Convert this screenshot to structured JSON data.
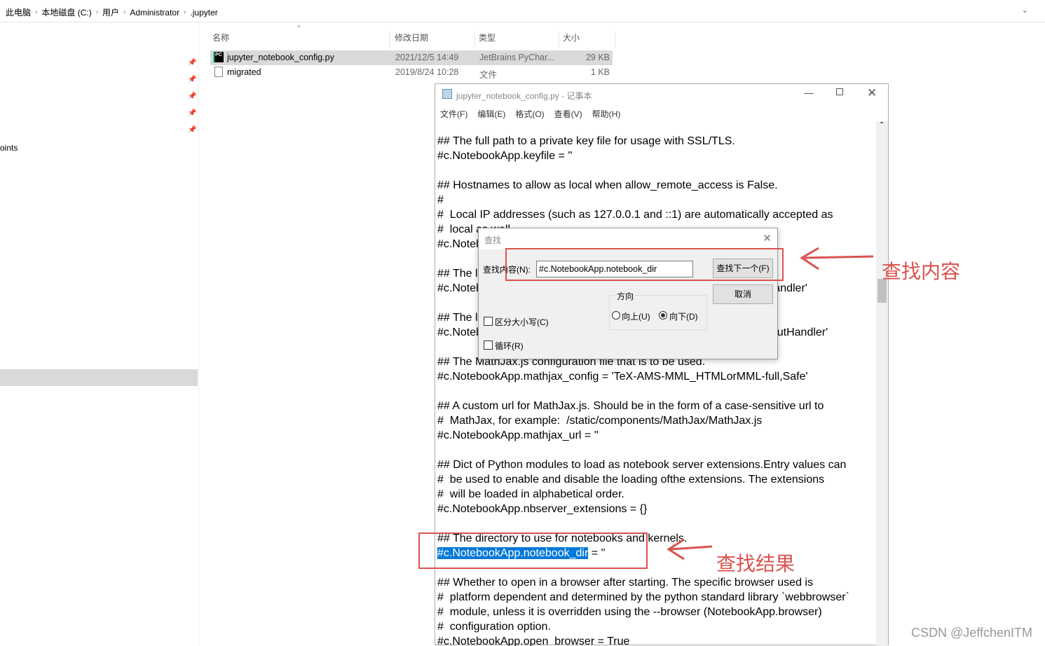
{
  "breadcrumb": [
    "此电脑",
    "本地磁盘 (C:)",
    "用户",
    "Administrator",
    ".jupyter"
  ],
  "left_pane_partial": "oints",
  "columns": [
    "名称",
    "修改日期",
    "类型",
    "大小"
  ],
  "files": [
    {
      "name": "jupyter_notebook_config.py",
      "date": "2021/12/5 14:49",
      "type": "JetBrains PyChar...",
      "size": "29 KB",
      "icon": "pycharm-file-icon"
    },
    {
      "name": "migrated",
      "date": "2019/8/24 10:28",
      "type": "文件",
      "size": "1 KB",
      "icon": "blank-file-icon"
    }
  ],
  "notepad": {
    "title": "jupyter_notebook_config.py - 记事本",
    "menu": [
      "文件(F)",
      "编辑(E)",
      "格式(O)",
      "查看(V)",
      "帮助(H)"
    ],
    "lines": [
      "## The full path to a private key file for usage with SSL/TLS.",
      "#c.NotebookApp.keyfile = ''",
      "",
      "## Hostnames to allow as local when allow_remote_access is False.",
      "#",
      "#  Local IP addresses (such as 127.0.0.1 and ::1) are automatically accepted as",
      "#  local as well.",
      "#c.NotebookApp.local_hostnames = ['localhost']",
      "",
      "## The login handler class to use.",
      "#c.NotebookApp.login_handler_class = 'notebook.auth.login.LoginHandler'",
      "",
      "## The logout handler class to use.",
      "#c.NotebookApp.logout_handler_class = 'notebook.auth.logout.LogoutHandler'",
      "",
      "## The MathJax.js configuration file that is to be used.",
      "#c.NotebookApp.mathjax_config = 'TeX-AMS-MML_HTMLorMML-full,Safe'",
      "",
      "## A custom url for MathJax.js. Should be in the form of a case-sensitive url to",
      "#  MathJax, for example:  /static/components/MathJax/MathJax.js",
      "#c.NotebookApp.mathjax_url = ''",
      "",
      "## Dict of Python modules to load as notebook server extensions.Entry values can",
      "#  be used to enable and disable the loading ofthe extensions. The extensions",
      "#  will be loaded in alphabetical order.",
      "#c.NotebookApp.nbserver_extensions = {}",
      "",
      "## The directory to use for notebooks and kernels.",
      "",
      "",
      "## Whether to open in a browser after starting. The specific browser used is",
      "#  platform dependent and determined by the python standard library `webbrowser`",
      "#  module, unless it is overridden using the --browser (NotebookApp.browser)",
      "#  configuration option.",
      "#c.NotebookApp.open_browser = True"
    ],
    "highlight_text": "#c.NotebookApp.notebook_dir",
    "highlight_rest": " = ''"
  },
  "find": {
    "title": "查找",
    "label": "查找内容(N):",
    "value": "#c.NotebookApp.notebook_dir",
    "find_next": "查找下一个(F)",
    "cancel": "取消",
    "direction": "方向",
    "up": "向上(U)",
    "down": "向下(D)",
    "match_case": "区分大小写(C)",
    "wrap": "循环(R)"
  },
  "annotations": {
    "find_content": "查找内容",
    "find_result": "查找结果"
  },
  "watermark": "CSDN @JeffchenITM",
  "colors": {
    "annotation": "#d9534f",
    "selection": "#0078d7"
  }
}
